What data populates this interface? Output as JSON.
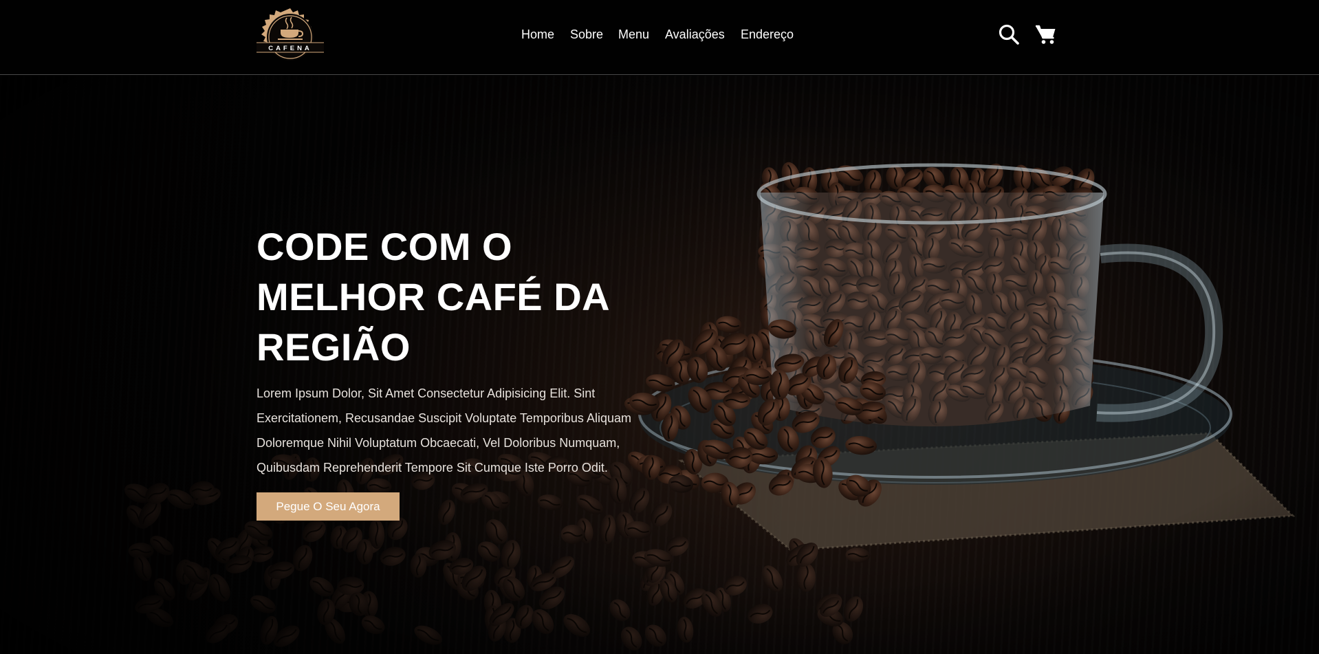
{
  "brand": {
    "logo_text": "CAFENA",
    "accent_color": "#d3a97c"
  },
  "nav": {
    "items": [
      {
        "label": "Home"
      },
      {
        "label": "Sobre"
      },
      {
        "label": "Menu"
      },
      {
        "label": "Avaliações"
      },
      {
        "label": "Endereço"
      }
    ]
  },
  "header_icons": {
    "search": "search-icon",
    "cart": "cart-icon"
  },
  "hero": {
    "title_lines": [
      "CODE COM O",
      "MELHOR CAFÉ DA",
      "REGIÃO"
    ],
    "text": "Lorem Ipsum Dolor, Sit Amet Consectetur Adipisicing Elit. Sint Exercitationem, Recusandae Suscipit Voluptate Temporibus Aliquam Doloremque Nihil Voluptatum Obcaecati, Vel Doloribus Numquam, Quibusdam Reprehenderit Tempore Sit Cumque Iste Porro Odit.",
    "cta_label": "Pegue O Seu Agora",
    "image": "coffee-beans-in-glass-cup"
  }
}
